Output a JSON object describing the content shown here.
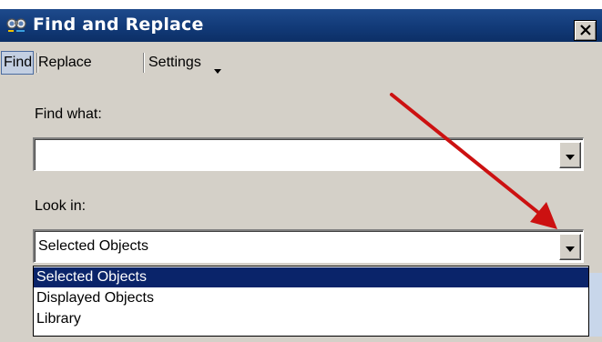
{
  "window": {
    "title": "Find and Replace",
    "title_icon": "binoculars-icon",
    "close_icon": "close-icon"
  },
  "tabs": [
    {
      "label": "Find",
      "active": true
    },
    {
      "label": "Replace",
      "active": false
    },
    {
      "label": "Settings",
      "active": false,
      "has_dropdown": true
    }
  ],
  "find_what": {
    "label": "Find what:",
    "value": ""
  },
  "look_in": {
    "label": "Look in:",
    "value": "Selected Objects",
    "options": [
      "Selected Objects",
      "Displayed Objects",
      "Library"
    ],
    "highlighted_option": "Selected Objects"
  },
  "annotation": {
    "type": "arrow",
    "color": "#cc1111",
    "points_to": "look-in-dropdown-button"
  },
  "colors": {
    "titlebar": "#123a78",
    "dialog_background": "#d4d0c8",
    "selection": "#0a246a",
    "active_tab": "#c3cfe2"
  }
}
